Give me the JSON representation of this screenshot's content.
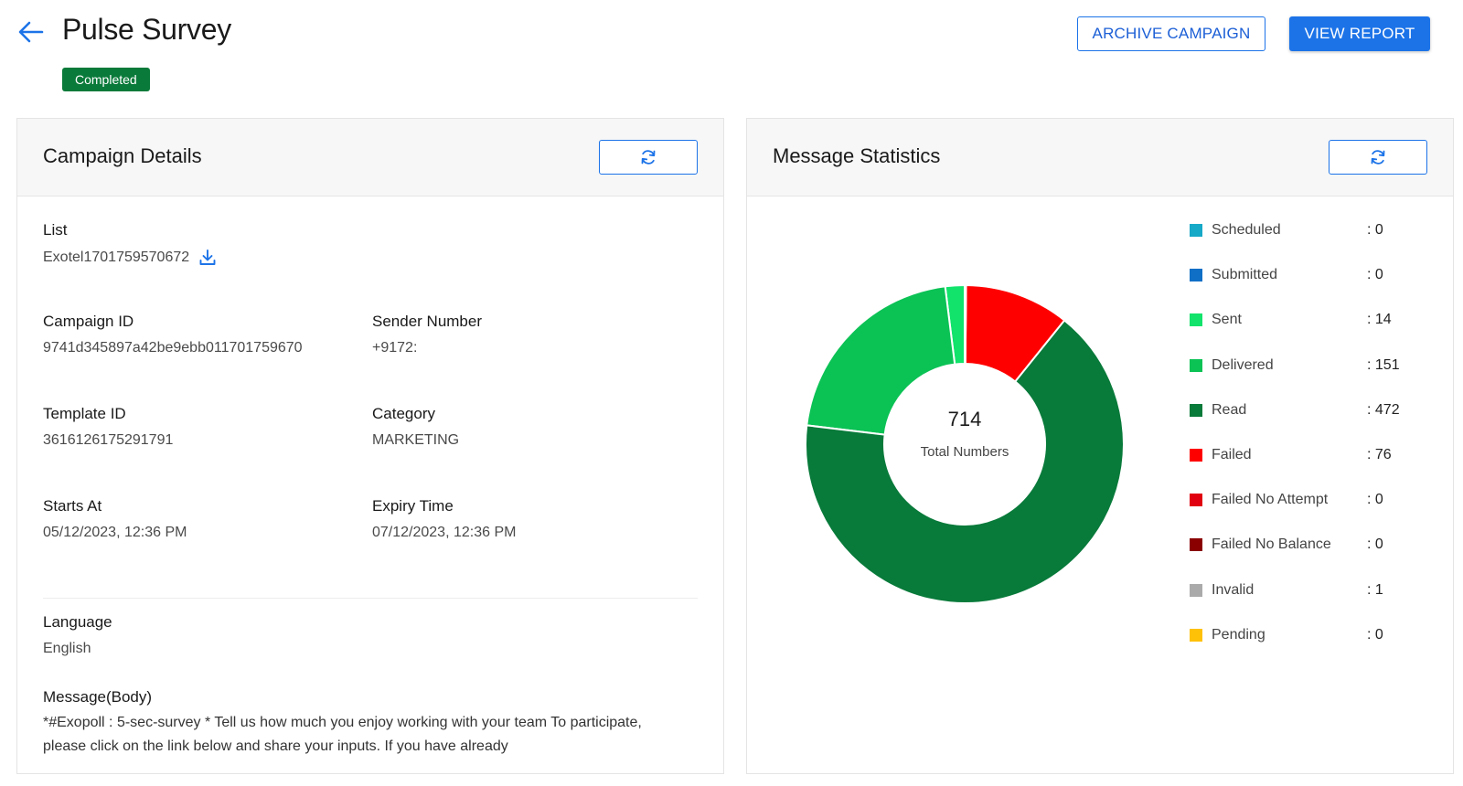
{
  "header": {
    "title": "Pulse Survey",
    "status": "Completed",
    "archive_label": "ARCHIVE CAMPAIGN",
    "report_label": "VIEW REPORT"
  },
  "campaign": {
    "title": "Campaign Details",
    "list_label": "List",
    "list_value": "Exotel1701759570672",
    "campaign_id_label": "Campaign ID",
    "campaign_id_value": "9741d345897a42be9ebb011701759670",
    "sender_label": "Sender Number",
    "sender_value": "+9172:",
    "template_label": "Template ID",
    "template_value": "3616126175291791",
    "category_label": "Category",
    "category_value": "MARKETING",
    "starts_label": "Starts At",
    "starts_value": "05/12/2023, 12:36 PM",
    "expiry_label": "Expiry Time",
    "expiry_value": "07/12/2023, 12:36 PM",
    "language_label": "Language",
    "language_value": "English",
    "message_label": "Message(Body)",
    "message_value": "*#Exopoll : 5-sec-survey * Tell us how much you enjoy working with your team To participate, please click on the link below and share your inputs. If you have already"
  },
  "stats": {
    "title": "Message Statistics",
    "total": "714",
    "total_caption": "Total Numbers",
    "legend": [
      {
        "label": "Scheduled",
        "value": ": 0",
        "color": "#17a9c8"
      },
      {
        "label": "Submitted",
        "value": ": 0",
        "color": "#0f6fc6"
      },
      {
        "label": "Sent",
        "value": ": 14",
        "color": "#11e36b"
      },
      {
        "label": "Delivered",
        "value": ": 151",
        "color": "#0bc255"
      },
      {
        "label": "Read",
        "value": ": 472",
        "color": "#087a3a"
      },
      {
        "label": "Failed",
        "value": ": 76",
        "color": "#ff0000"
      },
      {
        "label": "Failed No Attempt",
        "value": ": 0",
        "color": "#e0000f"
      },
      {
        "label": "Failed No Balance",
        "value": ": 0",
        "color": "#8a0000"
      },
      {
        "label": "Invalid",
        "value": ": 1",
        "color": "#aaaaaa"
      },
      {
        "label": "Pending",
        "value": ": 0",
        "color": "#ffc107"
      }
    ]
  },
  "chart_data": {
    "type": "pie",
    "categories": [
      "Scheduled",
      "Submitted",
      "Sent",
      "Delivered",
      "Read",
      "Failed",
      "Failed No Attempt",
      "Failed No Balance",
      "Invalid",
      "Pending"
    ],
    "values": [
      0,
      0,
      14,
      151,
      472,
      76,
      0,
      0,
      1,
      0
    ],
    "colors": [
      "#17a9c8",
      "#0f6fc6",
      "#11e36b",
      "#0bc255",
      "#087a3a",
      "#ff0000",
      "#e0000f",
      "#8a0000",
      "#aaaaaa",
      "#ffc107"
    ],
    "title": "Message Statistics",
    "donut": true,
    "center_text": "714",
    "legend_position": "right"
  },
  "colors": {
    "accent": "#1c73e8",
    "status_green": "#0a7a3a"
  }
}
